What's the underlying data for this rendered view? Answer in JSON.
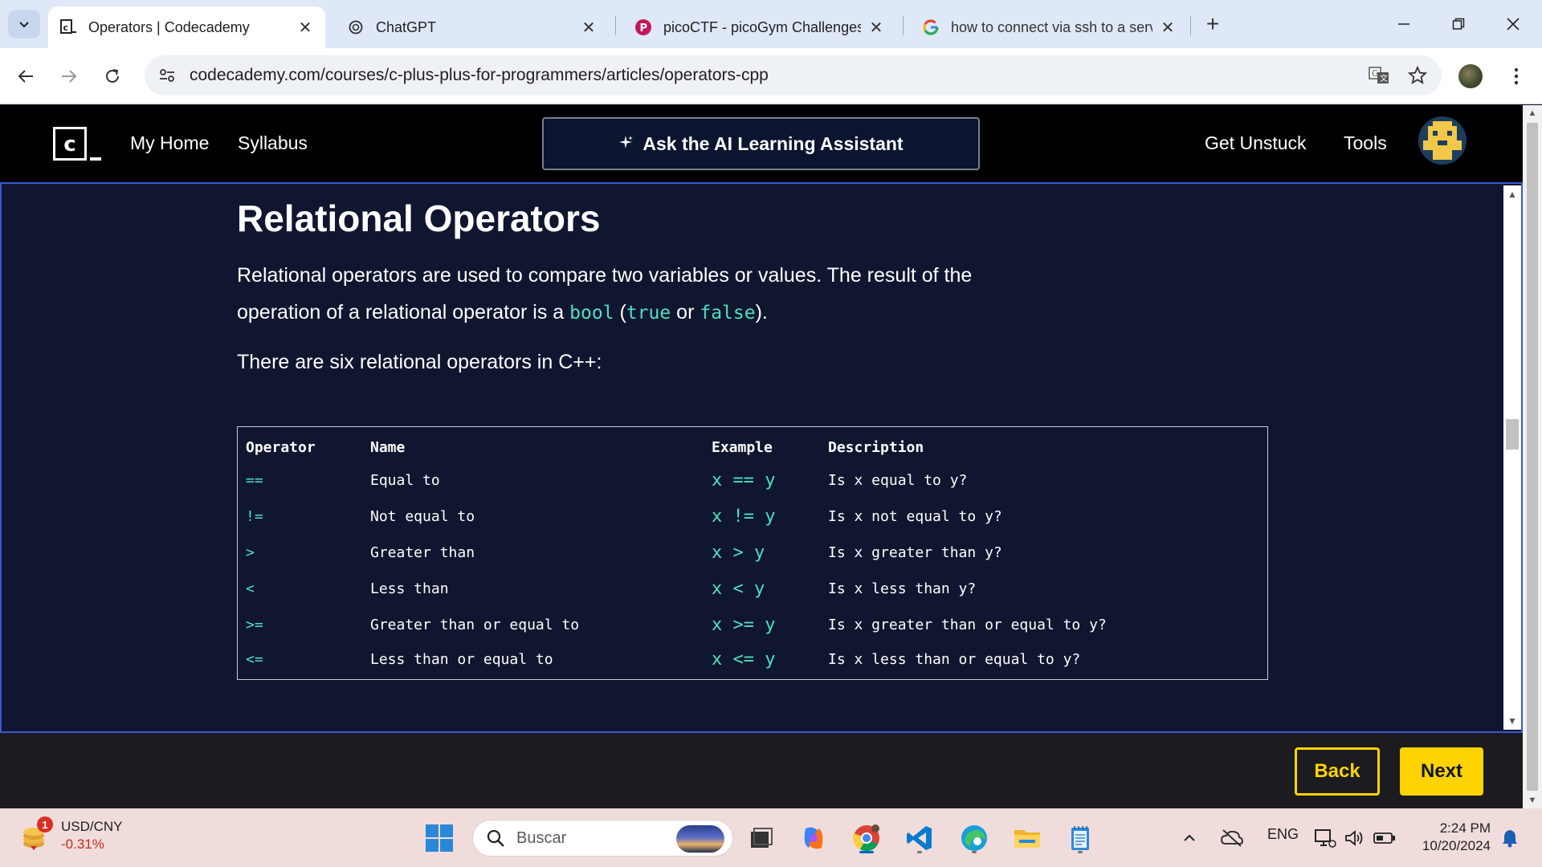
{
  "browser": {
    "tabs": [
      {
        "title": "Operators | Codecademy",
        "active": true,
        "favicon": "codecademy-favicon"
      },
      {
        "title": "ChatGPT",
        "active": false,
        "favicon": "chatgpt-favicon"
      },
      {
        "title": "picoCTF - picoGym Challenges",
        "active": false,
        "favicon": "picoctf-favicon"
      },
      {
        "title": "how to connect via ssh to a serv",
        "active": false,
        "favicon": "google-favicon"
      }
    ],
    "url": "codecademy.com/courses/c-plus-plus-for-programmers/articles/operators-cpp"
  },
  "header": {
    "logo_letter": "c",
    "nav_home": "My Home",
    "nav_syllabus": "Syllabus",
    "ai_button": "Ask the AI Learning Assistant",
    "nav_unstuck": "Get Unstuck",
    "nav_tools": "Tools"
  },
  "article": {
    "heading": "Relational Operators",
    "intro_text": "Relational operators are used to compare two variables or values. The result of the operation of a relational operator is a ",
    "code_bool": "bool",
    "paren_open": " (",
    "code_true": "true",
    "or_text": " or ",
    "code_false": "false",
    "paren_close": ").",
    "count_text": "There are six relational operators in C++:",
    "table": {
      "headers": [
        "Operator",
        "Name",
        "Example",
        "Description"
      ],
      "rows": [
        {
          "operator": "==",
          "name": "Equal to",
          "example": "x == y",
          "description": "Is x equal to y?"
        },
        {
          "operator": "!=",
          "name": "Not equal to",
          "example": "x != y",
          "description": "Is x not equal to y?"
        },
        {
          "operator": ">",
          "name": "Greater than",
          "example": "x > y",
          "description": "Is x greater than y?"
        },
        {
          "operator": "<",
          "name": "Less than",
          "example": "x < y",
          "description": "Is x less than y?"
        },
        {
          "operator": ">=",
          "name": "Greater than or equal to",
          "example": "x >= y",
          "description": "Is x greater than or equal to y?"
        },
        {
          "operator": "<=",
          "name": "Less than or equal to",
          "example": "x <= y",
          "description": "Is x less than or equal to y?"
        }
      ]
    }
  },
  "footer": {
    "back": "Back",
    "next": "Next"
  },
  "taskbar": {
    "widget_badge": "1",
    "widget_pair": "USD/CNY",
    "widget_change": "-0.31%",
    "search_placeholder": "Buscar",
    "language": "ENG",
    "time": "2:24 PM",
    "date": "10/20/2024"
  },
  "colors": {
    "accent_yellow": "#ffd300",
    "code_teal": "#4ee0c0",
    "page_bg": "#10162f",
    "focus_border": "#3b56d6"
  }
}
